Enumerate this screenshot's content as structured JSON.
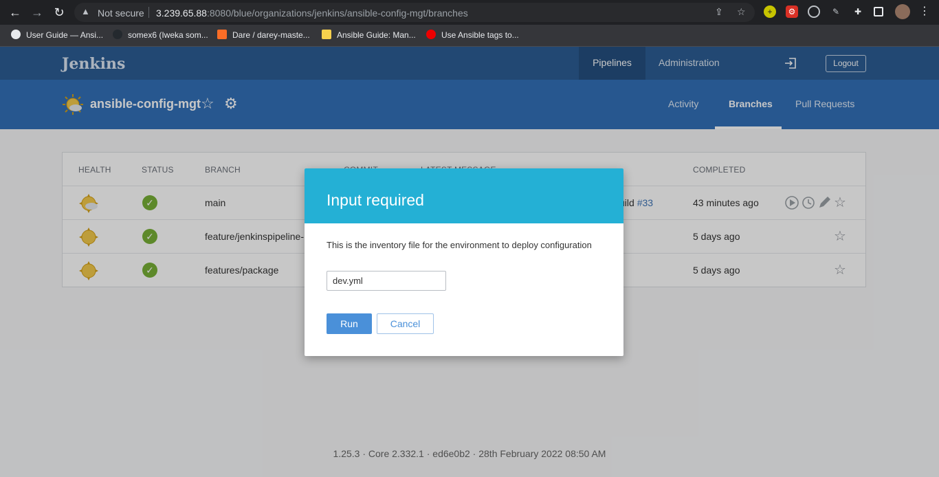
{
  "browser": {
    "security_label": "Not secure",
    "url_host": "3.239.65.88",
    "url_path": ":8080/blue/organizations/jenkins/ansible-config-mgt/branches",
    "bookmarks": [
      "User Guide — Ansi...",
      "somex6 (Iweka som...",
      "Dare / darey-maste...",
      "Ansible Guide: Man...",
      "Use Ansible tags to..."
    ]
  },
  "header": {
    "logo": "Jenkins",
    "nav_pipelines": "Pipelines",
    "nav_administration": "Administration",
    "logout": "Logout"
  },
  "project": {
    "name": "ansible-config-mgt",
    "tabs": [
      "Activity",
      "Branches",
      "Pull Requests"
    ],
    "active_tab": "Branches"
  },
  "table": {
    "columns": [
      "HEALTH",
      "STATUS",
      "BRANCH",
      "COMMIT",
      "LATEST MESSAGE",
      "COMPLETED"
    ],
    "rows": [
      {
        "branch": "main",
        "message": "uild ",
        "run": "#33",
        "completed": "43 minutes ago"
      },
      {
        "branch": "feature/jenkinspipeline-",
        "message": "",
        "run": "",
        "completed": "5 days ago"
      },
      {
        "branch": "features/package",
        "message": "",
        "run": "",
        "completed": "5 days ago"
      }
    ]
  },
  "modal": {
    "title": "Input required",
    "description": "This is the inventory file for the environment to deploy configuration",
    "input_value": "dev.yml",
    "run_label": "Run",
    "cancel_label": "Cancel"
  },
  "footer": "1.25.3 · Core 2.332.1 · ed6e0b2 · 28th February 2022 08:50 AM",
  "colors": {
    "header": "#2c5d94",
    "subheader": "#3370b8",
    "modal_header": "#24b0d5",
    "success": "#78b037",
    "primary_button": "#4a90d9"
  }
}
